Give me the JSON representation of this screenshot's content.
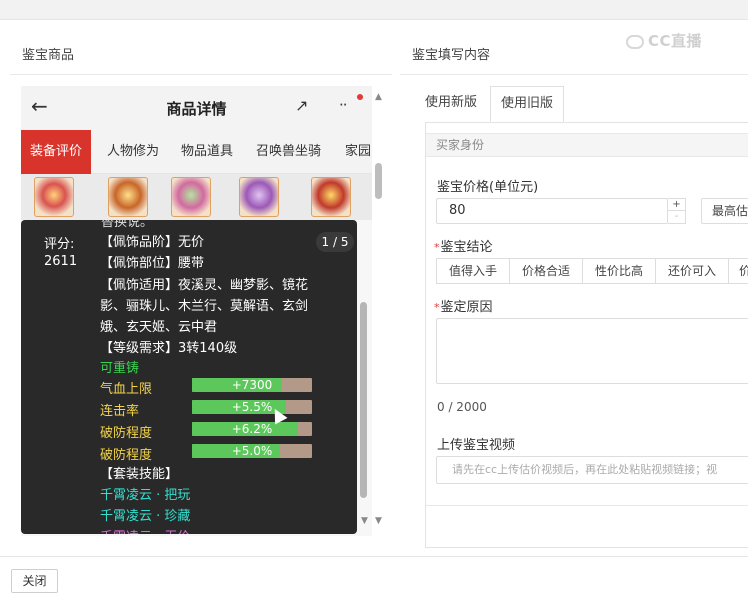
{
  "watermark": "CC直播",
  "left_section_title": "鉴宝商品",
  "right_section_title": "鉴宝填写内容",
  "phone": {
    "title": "商品详情",
    "back_icon": "←",
    "share_icon": "↗",
    "more_icon": "··",
    "tabs": [
      "装备评价",
      "人物修为",
      "物品道具",
      "召唤兽坐骑",
      "家园"
    ]
  },
  "tooltip": {
    "top_text": "替换说。",
    "score_label": "评分:",
    "score_value": "2611",
    "page": "1 / 5",
    "lines": [
      "【佩饰品阶】无价",
      "【佩饰部位】腰带",
      "【佩饰适用】夜溪灵、幽梦影、镜花",
      "影、骊珠儿、木兰行、莫解语、玄剑",
      "娥、玄天姬、云中君",
      "【等级需求】3转140级"
    ],
    "reforge": "可重铸",
    "stats": [
      {
        "label": "气血上限",
        "value_text": "+7300",
        "fill": 0.75
      },
      {
        "label": "连击率",
        "value_text": "+5.5%",
        "fill": 0.78
      },
      {
        "label": "破防程度",
        "value_text": "+6.2%",
        "fill": 0.88
      },
      {
        "label": "破防程度",
        "value_text": "+5.0%",
        "fill": 0.73
      }
    ],
    "set_skill_header": "【套装技能】",
    "set_skills": [
      "千霄凌云 · 把玩",
      "千霄凌云 · 珍藏",
      "千霄凌云 · 无价"
    ]
  },
  "form": {
    "tabs": [
      "使用新版",
      "使用旧版"
    ],
    "buyer_identity": "买家身份",
    "price_label": "鉴宝价格(单位元)",
    "price_value": "80",
    "max_estimate": "最高估",
    "conclusion_label": "鉴宝结论",
    "conclusion_options": [
      "值得入手",
      "价格合适",
      "性价比高",
      "还价可入",
      "价"
    ],
    "reason_label": "鉴定原因",
    "counter": "0 / 2000",
    "video_label": "上传鉴宝视频",
    "video_placeholder": "请先在cc上传估价视频后，再在此处粘贴视频链接；视"
  },
  "footer": {
    "close_label": "关闭"
  }
}
